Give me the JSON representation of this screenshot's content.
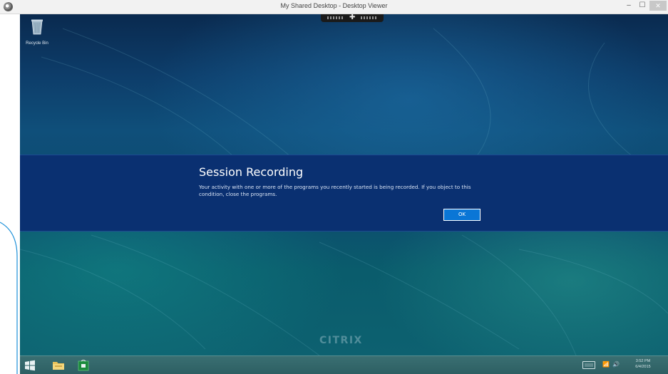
{
  "window": {
    "title": "My Shared Desktop - Desktop Viewer",
    "minimize_label": "–",
    "maximize_label": "☐",
    "close_label": "✕"
  },
  "connection_bar": {
    "center_symbol": "✚"
  },
  "desktop": {
    "icons": [
      {
        "label": "Recycle Bin",
        "icon": "recycle-bin-icon"
      }
    ],
    "watermark": "CITRIX"
  },
  "dialog": {
    "title": "Session Recording",
    "message": "Your activity with one or more of the programs you recently started is being recorded. If you object to this condition, close the programs.",
    "ok_label": "OK"
  },
  "taskbar": {
    "buttons": [
      {
        "name": "start",
        "icon": "windows-logo-icon"
      },
      {
        "name": "file-explorer",
        "icon": "folder-icon"
      },
      {
        "name": "store",
        "icon": "store-icon"
      }
    ],
    "tray": {
      "network_glyph": "📶",
      "volume_glyph": "🔊",
      "time": "3:52 PM",
      "date": "6/4/2015"
    }
  },
  "colors": {
    "banner": "#0a3071",
    "ok_button": "#0a76d6",
    "desktop": "#0f4f7a",
    "taskbar": "#2d5f63"
  }
}
